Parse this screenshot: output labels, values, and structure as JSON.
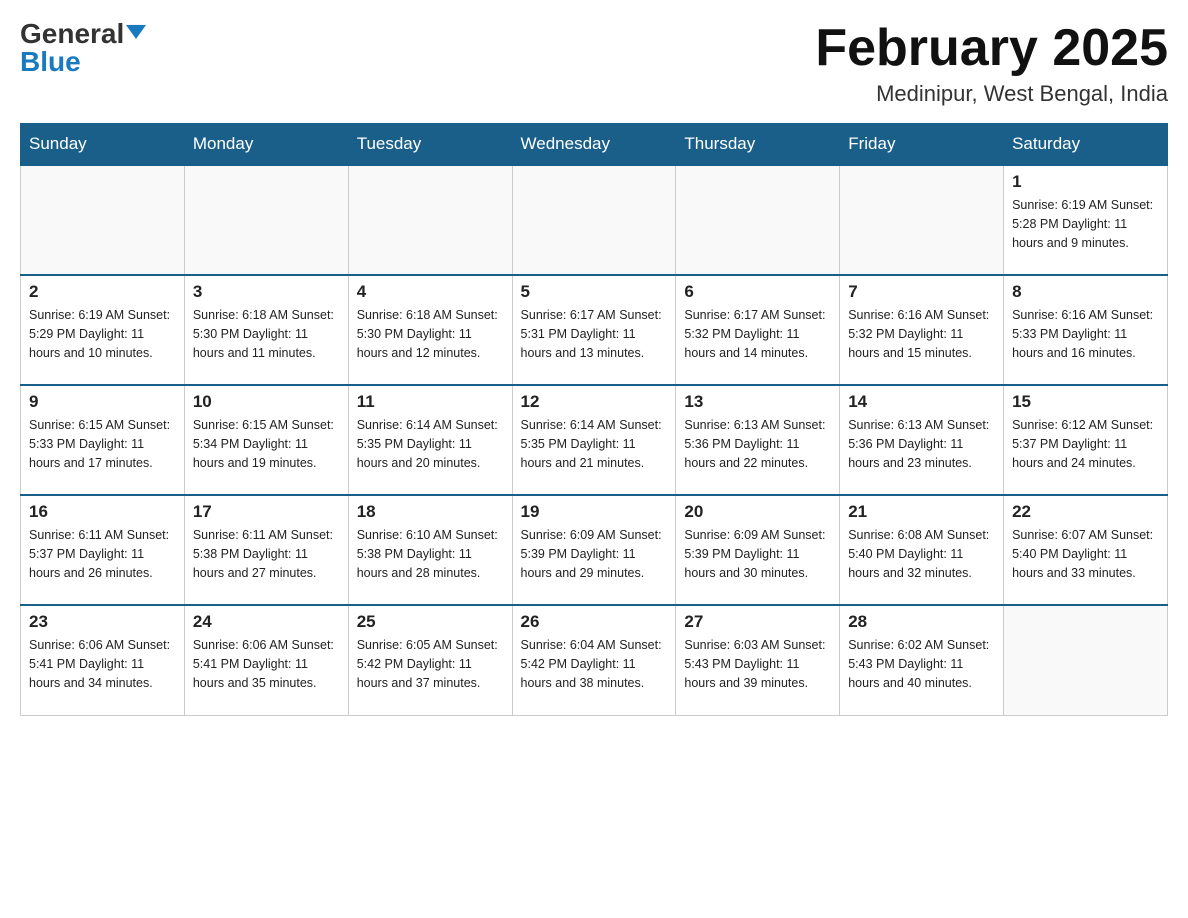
{
  "header": {
    "logo_general": "General",
    "logo_blue": "Blue",
    "month_title": "February 2025",
    "location": "Medinipur, West Bengal, India"
  },
  "days_of_week": [
    "Sunday",
    "Monday",
    "Tuesday",
    "Wednesday",
    "Thursday",
    "Friday",
    "Saturday"
  ],
  "weeks": [
    [
      {
        "day": "",
        "info": ""
      },
      {
        "day": "",
        "info": ""
      },
      {
        "day": "",
        "info": ""
      },
      {
        "day": "",
        "info": ""
      },
      {
        "day": "",
        "info": ""
      },
      {
        "day": "",
        "info": ""
      },
      {
        "day": "1",
        "info": "Sunrise: 6:19 AM\nSunset: 5:28 PM\nDaylight: 11 hours and 9 minutes."
      }
    ],
    [
      {
        "day": "2",
        "info": "Sunrise: 6:19 AM\nSunset: 5:29 PM\nDaylight: 11 hours and 10 minutes."
      },
      {
        "day": "3",
        "info": "Sunrise: 6:18 AM\nSunset: 5:30 PM\nDaylight: 11 hours and 11 minutes."
      },
      {
        "day": "4",
        "info": "Sunrise: 6:18 AM\nSunset: 5:30 PM\nDaylight: 11 hours and 12 minutes."
      },
      {
        "day": "5",
        "info": "Sunrise: 6:17 AM\nSunset: 5:31 PM\nDaylight: 11 hours and 13 minutes."
      },
      {
        "day": "6",
        "info": "Sunrise: 6:17 AM\nSunset: 5:32 PM\nDaylight: 11 hours and 14 minutes."
      },
      {
        "day": "7",
        "info": "Sunrise: 6:16 AM\nSunset: 5:32 PM\nDaylight: 11 hours and 15 minutes."
      },
      {
        "day": "8",
        "info": "Sunrise: 6:16 AM\nSunset: 5:33 PM\nDaylight: 11 hours and 16 minutes."
      }
    ],
    [
      {
        "day": "9",
        "info": "Sunrise: 6:15 AM\nSunset: 5:33 PM\nDaylight: 11 hours and 17 minutes."
      },
      {
        "day": "10",
        "info": "Sunrise: 6:15 AM\nSunset: 5:34 PM\nDaylight: 11 hours and 19 minutes."
      },
      {
        "day": "11",
        "info": "Sunrise: 6:14 AM\nSunset: 5:35 PM\nDaylight: 11 hours and 20 minutes."
      },
      {
        "day": "12",
        "info": "Sunrise: 6:14 AM\nSunset: 5:35 PM\nDaylight: 11 hours and 21 minutes."
      },
      {
        "day": "13",
        "info": "Sunrise: 6:13 AM\nSunset: 5:36 PM\nDaylight: 11 hours and 22 minutes."
      },
      {
        "day": "14",
        "info": "Sunrise: 6:13 AM\nSunset: 5:36 PM\nDaylight: 11 hours and 23 minutes."
      },
      {
        "day": "15",
        "info": "Sunrise: 6:12 AM\nSunset: 5:37 PM\nDaylight: 11 hours and 24 minutes."
      }
    ],
    [
      {
        "day": "16",
        "info": "Sunrise: 6:11 AM\nSunset: 5:37 PM\nDaylight: 11 hours and 26 minutes."
      },
      {
        "day": "17",
        "info": "Sunrise: 6:11 AM\nSunset: 5:38 PM\nDaylight: 11 hours and 27 minutes."
      },
      {
        "day": "18",
        "info": "Sunrise: 6:10 AM\nSunset: 5:38 PM\nDaylight: 11 hours and 28 minutes."
      },
      {
        "day": "19",
        "info": "Sunrise: 6:09 AM\nSunset: 5:39 PM\nDaylight: 11 hours and 29 minutes."
      },
      {
        "day": "20",
        "info": "Sunrise: 6:09 AM\nSunset: 5:39 PM\nDaylight: 11 hours and 30 minutes."
      },
      {
        "day": "21",
        "info": "Sunrise: 6:08 AM\nSunset: 5:40 PM\nDaylight: 11 hours and 32 minutes."
      },
      {
        "day": "22",
        "info": "Sunrise: 6:07 AM\nSunset: 5:40 PM\nDaylight: 11 hours and 33 minutes."
      }
    ],
    [
      {
        "day": "23",
        "info": "Sunrise: 6:06 AM\nSunset: 5:41 PM\nDaylight: 11 hours and 34 minutes."
      },
      {
        "day": "24",
        "info": "Sunrise: 6:06 AM\nSunset: 5:41 PM\nDaylight: 11 hours and 35 minutes."
      },
      {
        "day": "25",
        "info": "Sunrise: 6:05 AM\nSunset: 5:42 PM\nDaylight: 11 hours and 37 minutes."
      },
      {
        "day": "26",
        "info": "Sunrise: 6:04 AM\nSunset: 5:42 PM\nDaylight: 11 hours and 38 minutes."
      },
      {
        "day": "27",
        "info": "Sunrise: 6:03 AM\nSunset: 5:43 PM\nDaylight: 11 hours and 39 minutes."
      },
      {
        "day": "28",
        "info": "Sunrise: 6:02 AM\nSunset: 5:43 PM\nDaylight: 11 hours and 40 minutes."
      },
      {
        "day": "",
        "info": ""
      }
    ]
  ]
}
